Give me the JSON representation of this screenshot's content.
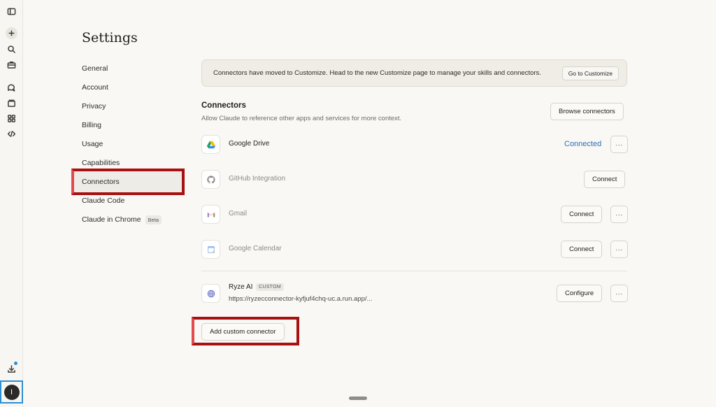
{
  "rail": {
    "icons": [
      "sidebar-toggle-icon",
      "plus-icon",
      "search-icon",
      "briefcase-icon",
      "chats-icon",
      "projects-icon",
      "artifacts-icon",
      "code-icon",
      "download-icon"
    ],
    "avatar_initial": "I"
  },
  "page": {
    "title": "Settings"
  },
  "nav": {
    "items": [
      {
        "label": "General"
      },
      {
        "label": "Account"
      },
      {
        "label": "Privacy"
      },
      {
        "label": "Billing"
      },
      {
        "label": "Usage"
      },
      {
        "label": "Capabilities"
      },
      {
        "label": "Connectors",
        "active": true
      },
      {
        "label": "Claude Code"
      },
      {
        "label": "Claude in Chrome",
        "badge": "Beta"
      }
    ]
  },
  "notice": {
    "text": "Connectors have moved to Customize. Head to the new Customize page to manage your skills and connectors.",
    "button": "Go to Customize"
  },
  "connectors": {
    "title": "Connectors",
    "subtitle": "Allow Claude to reference other apps and services for more context.",
    "browse_button": "Browse connectors",
    "more_label": "···",
    "rows": [
      {
        "name": "Google Drive",
        "status": "Connected",
        "icon": "google-drive-icon"
      },
      {
        "name": "GitHub Integration",
        "action": "Connect",
        "icon": "github-icon"
      },
      {
        "name": "Gmail",
        "action": "Connect",
        "icon": "gmail-icon"
      },
      {
        "name": "Google Calendar",
        "action": "Connect",
        "icon": "google-calendar-icon"
      }
    ],
    "custom": {
      "name": "Ryze AI",
      "tag": "CUSTOM",
      "url": "https://ryzecconnector-kyfjuf4chq-uc.a.run.app/...",
      "action": "Configure",
      "icon": "globe-icon"
    },
    "add_button": "Add custom connector"
  },
  "colors": {
    "background": "#f9f8f5",
    "connected": "#2e6fb6",
    "highlight": "#a81012",
    "accent_dot": "#2d8fd6"
  }
}
